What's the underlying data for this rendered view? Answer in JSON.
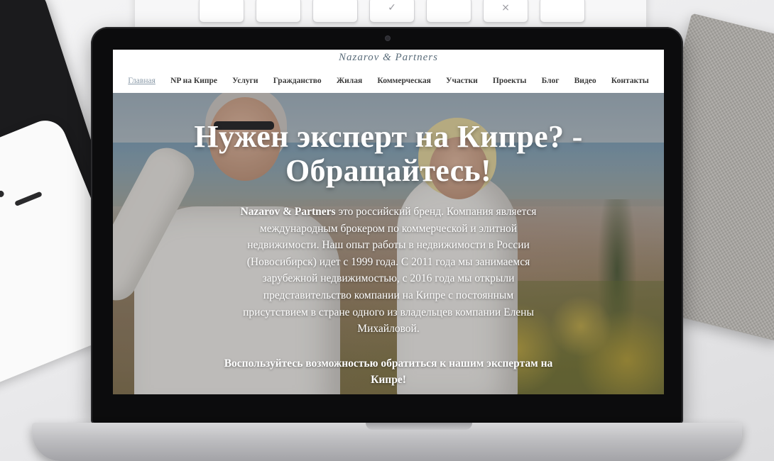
{
  "desk": {
    "keyboard_keys": [
      "",
      "",
      "",
      "✓",
      "",
      "×",
      ""
    ]
  },
  "site": {
    "logo": "Nazarov & Partners",
    "nav": [
      {
        "label": "Главная",
        "active": true
      },
      {
        "label": "NP на Кипре"
      },
      {
        "label": "Услуги"
      },
      {
        "label": "Гражданство"
      },
      {
        "label": "Жилая"
      },
      {
        "label": "Коммерческая"
      },
      {
        "label": "Участки"
      },
      {
        "label": "Проекты"
      },
      {
        "label": "Блог"
      },
      {
        "label": "Видео"
      },
      {
        "label": "Контакты"
      }
    ]
  },
  "hero": {
    "title_line1": "Нужен эксперт на Кипре? -",
    "title_line2": "Обращайтесь!",
    "brand": "Nazarov & Partners",
    "text": " это российский бренд. Компания является международным брокером по коммерческой и элитной недвижимости. Наш опыт работы в недвижимости в России (Новосибирск) идет с 1999 года. С 2011 года мы занимаемся зарубежной недвижимостью, с 2016 года мы открыли представительство компании на Кипре с постоянным присутствием в стране одного из владельцев компании Елены Михайловой.",
    "cta": "Воспользуйтесь возможностью обратиться к нашим экспертам на Кипре!"
  }
}
